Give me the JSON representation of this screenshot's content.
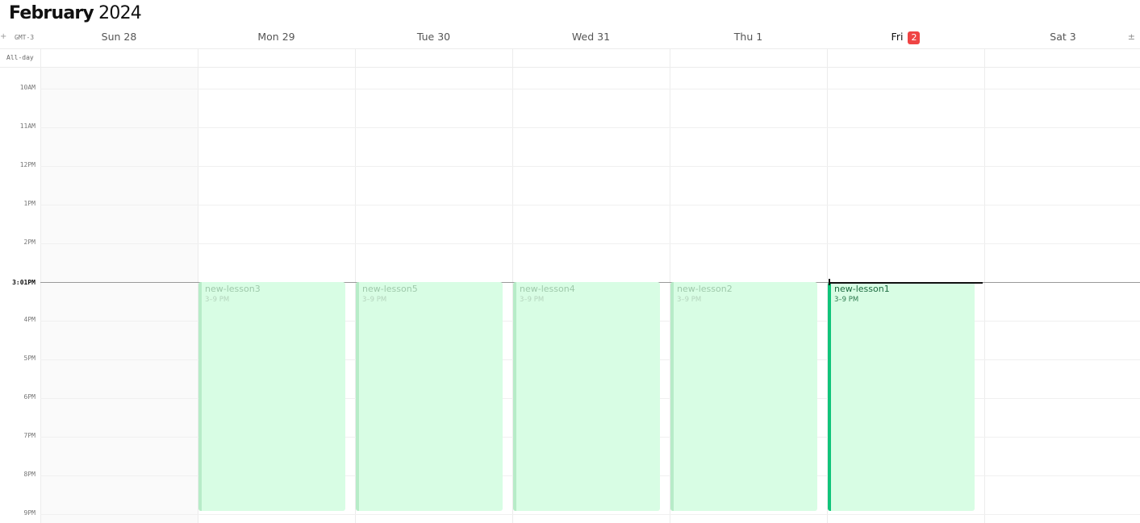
{
  "header": {
    "month": "February",
    "year": "2024"
  },
  "timezone": {
    "label": "GMT-3",
    "left_control": "+",
    "right_control": "±"
  },
  "allday_label": "All-day",
  "days": [
    {
      "label": "Sun 28"
    },
    {
      "label": "Mon 29"
    },
    {
      "label": "Tue 30"
    },
    {
      "label": "Wed 31"
    },
    {
      "label": "Thu 1"
    },
    {
      "label": "Fri",
      "badge": "2",
      "today": true
    },
    {
      "label": "Sat 3"
    }
  ],
  "hours": [
    "10AM",
    "11AM",
    "12PM",
    "1PM",
    "2PM",
    "4PM",
    "5PM",
    "6PM",
    "7PM",
    "8PM",
    "9PM"
  ],
  "now_label": "3:01PM",
  "events": [
    {
      "title": "new-lesson3",
      "time": "3–9 PM",
      "day": 1
    },
    {
      "title": "new-lesson5",
      "time": "3–9 PM",
      "day": 2
    },
    {
      "title": "new-lesson4",
      "time": "3–9 PM",
      "day": 3
    },
    {
      "title": "new-lesson2",
      "time": "3–9 PM",
      "day": 4
    },
    {
      "title": "new-lesson1",
      "time": "3–9 PM",
      "day": 5,
      "active": true
    }
  ],
  "colors": {
    "event_bg": "#d8fde4",
    "event_border_active": "#10c47a",
    "today_badge": "#ef4444"
  }
}
